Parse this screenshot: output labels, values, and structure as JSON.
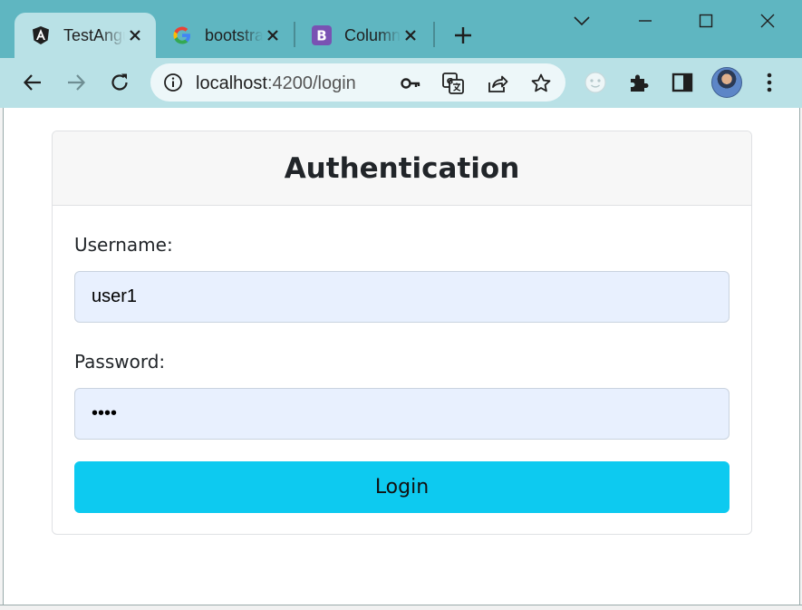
{
  "browser": {
    "tabs": [
      {
        "title": "TestAngular",
        "icon": "angular-icon",
        "active": true
      },
      {
        "title": "bootstrap",
        "icon": "google-icon",
        "active": false
      },
      {
        "title": "Columns",
        "icon": "bootstrap-icon",
        "active": false
      }
    ],
    "address": {
      "host": "localhost",
      "path": ":4200/login"
    },
    "colors": {
      "tabstrip": "#5fb6c1",
      "toolbar": "#b9e1e6"
    }
  },
  "page": {
    "heading": "Authentication",
    "username": {
      "label": "Username:",
      "value": "user1"
    },
    "password": {
      "label": "Password:",
      "value": "1234"
    },
    "login_label": "Login",
    "colors": {
      "input_bg": "#e8f0fe",
      "button_bg": "#0dcaf0"
    }
  }
}
